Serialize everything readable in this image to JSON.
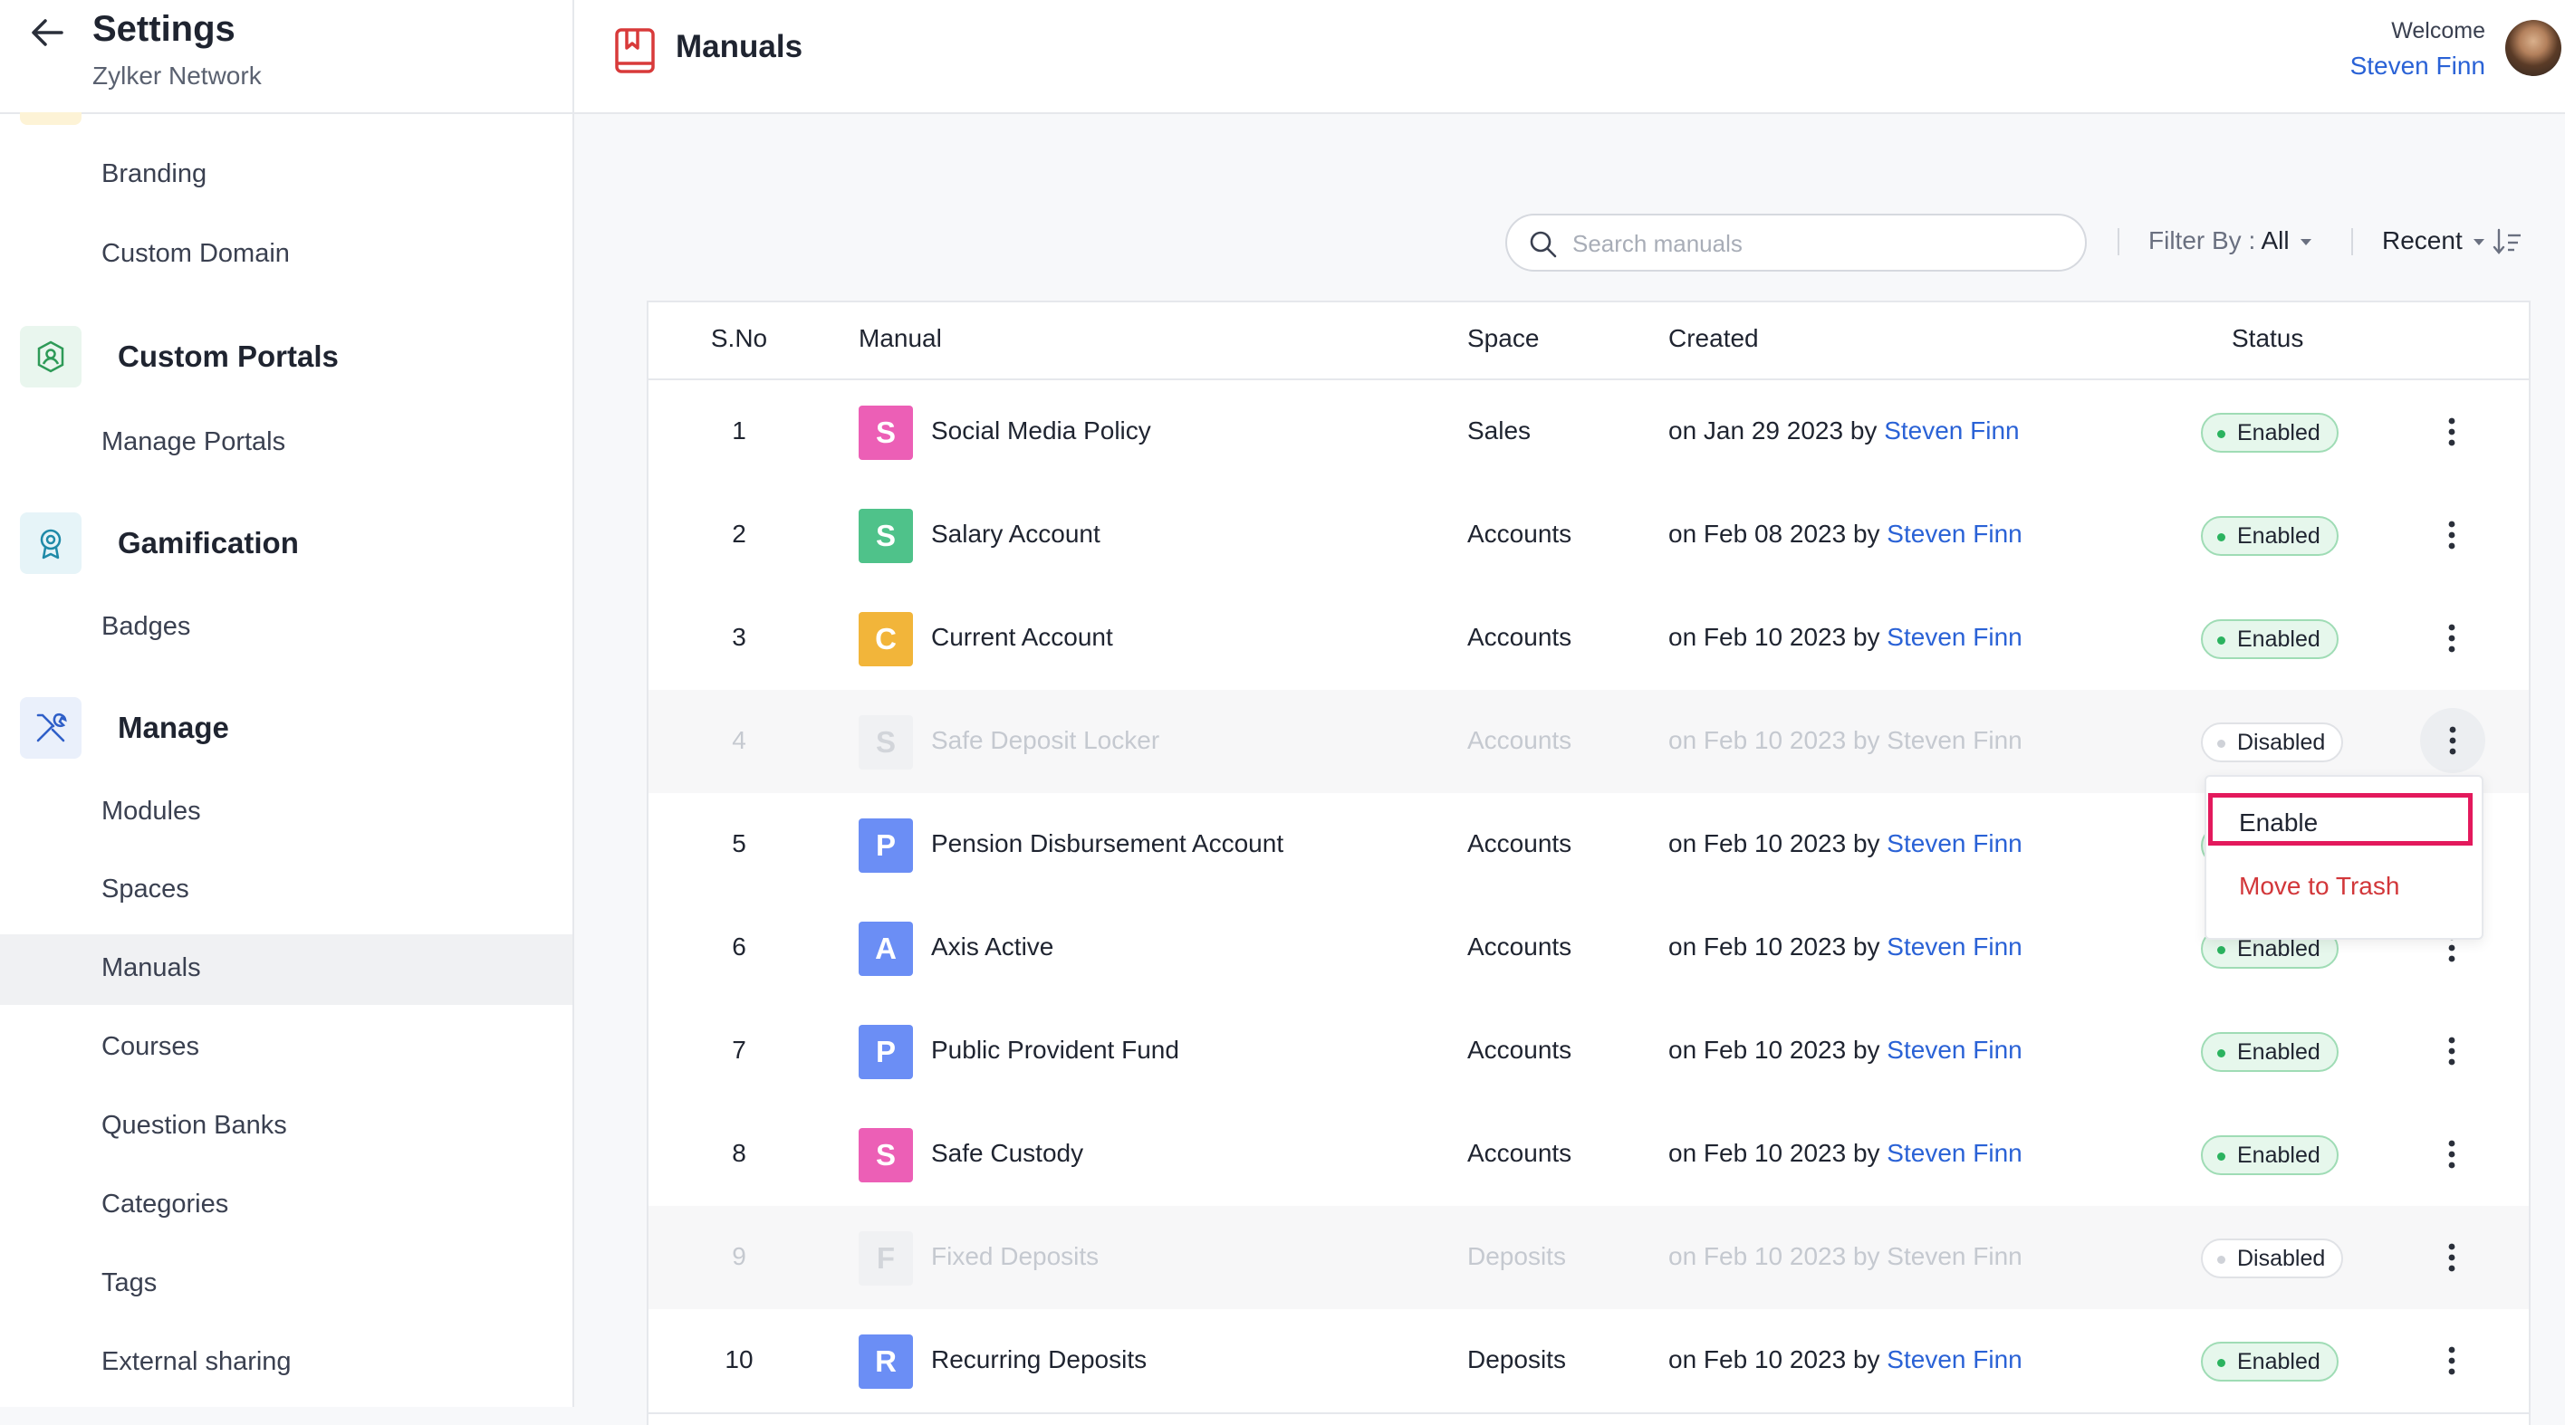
{
  "sidebar": {
    "title": "Settings",
    "subtitle": "Zylker Network",
    "items": [
      {
        "label": "Branding"
      },
      {
        "label": "Custom Domain"
      },
      {
        "label": "Manage Portals"
      },
      {
        "label": "Badges"
      },
      {
        "label": "Modules"
      },
      {
        "label": "Spaces"
      },
      {
        "label": "Manuals",
        "active": true
      },
      {
        "label": "Courses"
      },
      {
        "label": "Question Banks"
      },
      {
        "label": "Categories"
      },
      {
        "label": "Tags"
      },
      {
        "label": "External sharing"
      }
    ],
    "groups": [
      {
        "label": "Custom Portals",
        "icon": "portal-icon",
        "color": "#e9f6ee"
      },
      {
        "label": "Gamification",
        "icon": "award-icon",
        "color": "#e6f4f8"
      },
      {
        "label": "Manage",
        "icon": "tools-icon",
        "color": "#eaf0fb"
      }
    ]
  },
  "header": {
    "title": "Manuals",
    "welcome": "Welcome",
    "user": "Steven Finn"
  },
  "toolbar": {
    "search_placeholder": "Search manuals",
    "filter_label": "Filter By :",
    "filter_value": "All",
    "sort_label": "Recent"
  },
  "table": {
    "columns": {
      "sno": "S.No",
      "manual": "Manual",
      "space": "Space",
      "created": "Created",
      "status": "Status"
    },
    "rows": [
      {
        "sno": "1",
        "letter": "S",
        "color": "#ec5fb6",
        "name": "Social Media Policy",
        "space": "Sales",
        "created": "on Jan 29 2023 by",
        "author": "Steven Finn",
        "status": "Enabled",
        "enabled": true
      },
      {
        "sno": "2",
        "letter": "S",
        "color": "#4fc28a",
        "name": "Salary Account",
        "space": "Accounts",
        "created": "on Feb 08 2023 by",
        "author": "Steven Finn",
        "status": "Enabled",
        "enabled": true
      },
      {
        "sno": "3",
        "letter": "C",
        "color": "#f2b53a",
        "name": "Current Account",
        "space": "Accounts",
        "created": "on Feb 10 2023 by",
        "author": "Steven Finn",
        "status": "Enabled",
        "enabled": true
      },
      {
        "sno": "4",
        "letter": "S",
        "color": "#f0f1f3",
        "name": "Safe Deposit Locker",
        "space": "Accounts",
        "created": "on Feb 10 2023 by",
        "author": "Steven Finn",
        "status": "Disabled",
        "enabled": false
      },
      {
        "sno": "5",
        "letter": "P",
        "color": "#6b8ef5",
        "name": "Pension Disbursement Account",
        "space": "Accounts",
        "created": "on Feb 10 2023 by",
        "author": "Steven Finn",
        "status": "Enabled",
        "enabled": true
      },
      {
        "sno": "6",
        "letter": "A",
        "color": "#6b8ef5",
        "name": "Axis Active",
        "space": "Accounts",
        "created": "on Feb 10 2023 by",
        "author": "Steven Finn",
        "status": "Enabled",
        "enabled": true
      },
      {
        "sno": "7",
        "letter": "P",
        "color": "#6b8ef5",
        "name": "Public Provident Fund",
        "space": "Accounts",
        "created": "on Feb 10 2023 by",
        "author": "Steven Finn",
        "status": "Enabled",
        "enabled": true
      },
      {
        "sno": "8",
        "letter": "S",
        "color": "#ec5fb6",
        "name": "Safe Custody",
        "space": "Accounts",
        "created": "on Feb 10 2023 by",
        "author": "Steven Finn",
        "status": "Enabled",
        "enabled": true
      },
      {
        "sno": "9",
        "letter": "F",
        "color": "#f0f1f3",
        "name": "Fixed Deposits",
        "space": "Deposits",
        "created": "on Feb 10 2023 by",
        "author": "Steven Finn",
        "status": "Disabled",
        "enabled": false
      },
      {
        "sno": "10",
        "letter": "R",
        "color": "#6b8ef5",
        "name": "Recurring Deposits",
        "space": "Deposits",
        "created": "on Feb 10 2023 by",
        "author": "Steven Finn",
        "status": "Enabled",
        "enabled": true
      }
    ]
  },
  "context_menu": {
    "enable": "Enable",
    "trash": "Move to Trash",
    "highlight_color": "#e3195c",
    "trash_color": "#d2373a"
  },
  "colors": {
    "accent": "#2a62d6",
    "enabled_green": "#2bb35f"
  }
}
